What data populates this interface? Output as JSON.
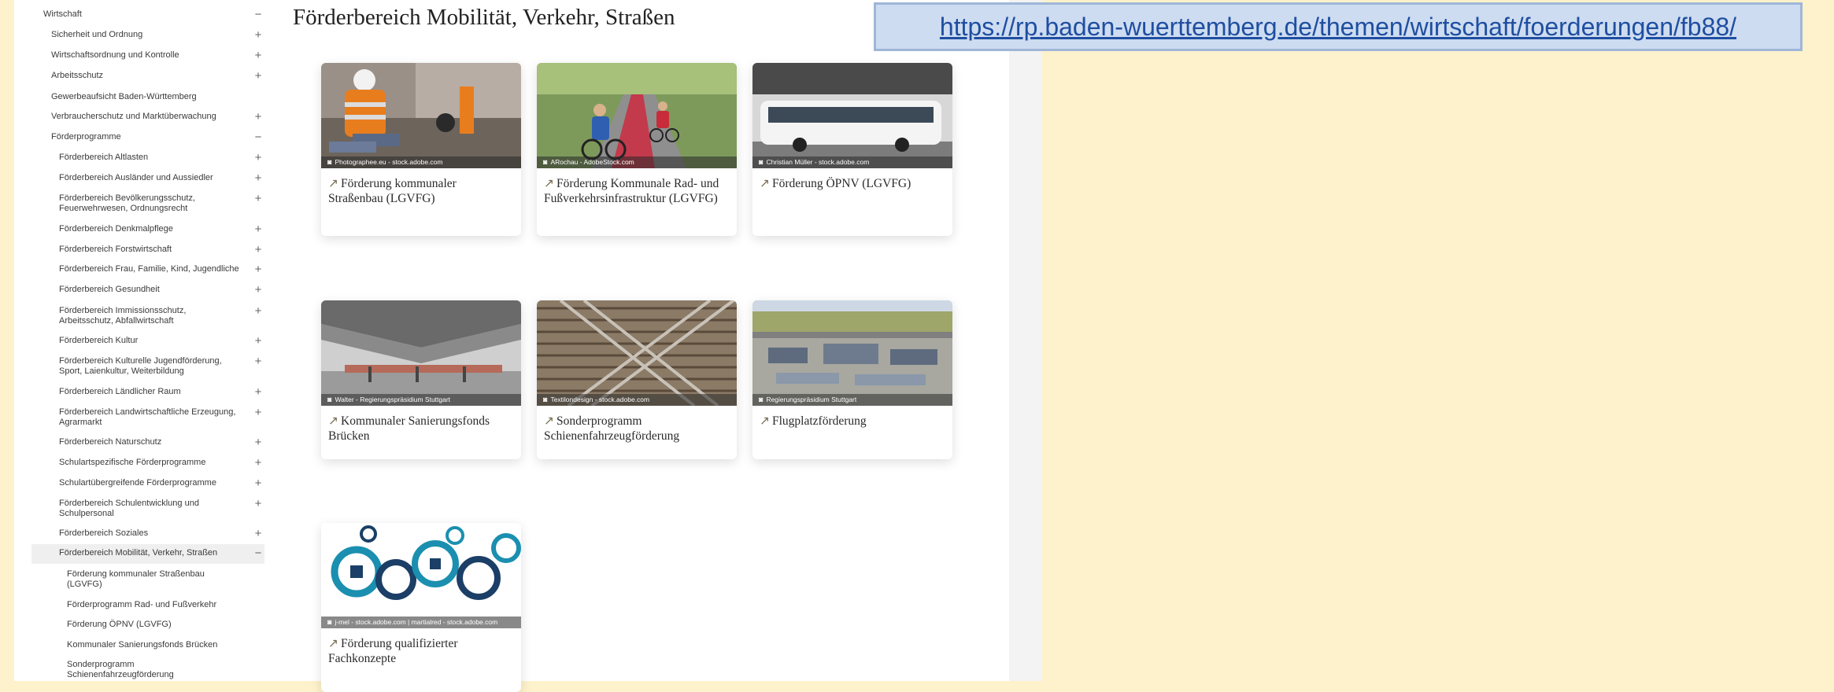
{
  "sidebar": {
    "items": [
      {
        "label": "Wirtschaft",
        "toggle": "−"
      },
      {
        "label": "Sicherheit und Ordnung",
        "toggle": "+"
      },
      {
        "label": "Wirtschaftsordnung und Kontrolle",
        "toggle": "+"
      },
      {
        "label": "Arbeitsschutz",
        "toggle": "+"
      },
      {
        "label": "Gewerbeaufsicht Baden-Württemberg",
        "toggle": ""
      },
      {
        "label": "Verbraucherschutz und Marktüberwachung",
        "toggle": "+"
      },
      {
        "label": "Förderprogramme",
        "toggle": "−"
      },
      {
        "label": "Förderbereich Altlasten",
        "toggle": "+"
      },
      {
        "label": "Förderbereich Ausländer und Aussiedler",
        "toggle": "+"
      },
      {
        "label": "Förderbereich Bevölkerungsschutz, Feuerwehrwesen, Ordnungsrecht",
        "toggle": "+"
      },
      {
        "label": "Förderbereich Denkmalpflege",
        "toggle": "+"
      },
      {
        "label": "Förderbereich Forstwirtschaft",
        "toggle": "+"
      },
      {
        "label": "Förderbereich Frau, Familie, Kind, Jugendliche",
        "toggle": "+"
      },
      {
        "label": "Förderbereich Gesundheit",
        "toggle": "+"
      },
      {
        "label": "Förderbereich Immissionsschutz, Arbeitsschutz, Abfallwirtschaft",
        "toggle": "+"
      },
      {
        "label": "Förderbereich Kultur",
        "toggle": "+"
      },
      {
        "label": "Förderbereich Kulturelle Jugendförderung, Sport, Laienkultur, Weiterbildung",
        "toggle": "+"
      },
      {
        "label": "Förderbereich Ländlicher Raum",
        "toggle": "+"
      },
      {
        "label": "Förderbereich Landwirtschaftliche Erzeugung, Agrarmarkt",
        "toggle": "+"
      },
      {
        "label": "Förderbereich Naturschutz",
        "toggle": "+"
      },
      {
        "label": "Schulartspezifische Förderprogramme",
        "toggle": "+"
      },
      {
        "label": "Schulartübergreifende Förderprogramme",
        "toggle": "+"
      },
      {
        "label": "Förderbereich Schulentwicklung und Schulpersonal",
        "toggle": "+"
      },
      {
        "label": "Förderbereich Soziales",
        "toggle": "+"
      },
      {
        "label": "Förderbereich Mobilität, Verkehr, Straßen",
        "toggle": "−"
      },
      {
        "label": "Förderung kommunaler Straßenbau (LGVFG)",
        "toggle": ""
      },
      {
        "label": "Förderprogramm Rad- und Fußverkehr",
        "toggle": ""
      },
      {
        "label": "Förderung ÖPNV (LGVFG)",
        "toggle": ""
      },
      {
        "label": "Kommunaler Sanierungsfonds Brücken",
        "toggle": ""
      },
      {
        "label": "Sonderprogramm Schienenfahrzeugförderung",
        "toggle": ""
      }
    ]
  },
  "main": {
    "title": "Förderbereich Mobilität, Verkehr, Straßen",
    "cards": [
      {
        "title": "Förderung kommunaler Straßenbau (LGVFG)",
        "credit": "Photographee.eu - stock.adobe.com",
        "arrow": "↗"
      },
      {
        "title": "Förderung Kommunale Rad- und Fußverkehrsinfrastruktur (LGVFG)",
        "credit": "ARochau - AdobeStock.com",
        "arrow": "↗"
      },
      {
        "title": "Förderung ÖPNV (LGVFG)",
        "credit": "Christian Müller - stock.adobe.com",
        "arrow": "↗"
      },
      {
        "title": "Kommunaler Sanierungsfonds Brücken",
        "credit": "Walter - Regierungspräsidium Stuttgart",
        "arrow": "↗"
      },
      {
        "title": "Sonderprogramm Schienenfahrzeugförderung",
        "credit": "Textilondesign - stock.adobe.com",
        "arrow": "↗"
      },
      {
        "title": "Flugplatzförderung",
        "credit": "Regierungspräsidium Stuttgart",
        "arrow": "↗"
      },
      {
        "title": "Förderung qualifizierter Fachkonzepte",
        "credit": "j-mel - stock.adobe.com | martialred - stock.adobe.com",
        "arrow": "↗"
      }
    ]
  },
  "url_banner": {
    "text": "https://rp.baden-wuerttemberg.de/themen/wirtschaft/foerderungen/fb88/"
  },
  "colors": {
    "background": "#fdf2cb",
    "link": "#1f4ea1",
    "banner": "#cddcf0"
  }
}
